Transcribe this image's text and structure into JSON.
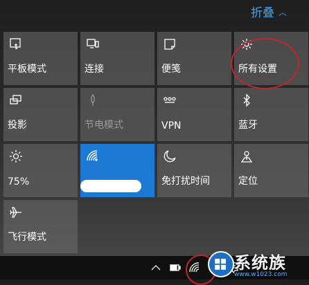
{
  "header": {
    "collapse_label": "折叠"
  },
  "tiles": [
    {
      "label": "平板模式",
      "icon": "tablet-mode-icon",
      "state": "off"
    },
    {
      "label": "连接",
      "icon": "connect-icon",
      "state": "off"
    },
    {
      "label": "便笺",
      "icon": "note-icon",
      "state": "off"
    },
    {
      "label": "所有设置",
      "icon": "gear-icon",
      "state": "off"
    },
    {
      "label": "投影",
      "icon": "project-icon",
      "state": "off"
    },
    {
      "label": "节电模式",
      "icon": "battery-saver-icon",
      "state": "disabled"
    },
    {
      "label": "VPN",
      "icon": "vpn-icon",
      "state": "off"
    },
    {
      "label": "蓝牙",
      "icon": "bluetooth-icon",
      "state": "off"
    },
    {
      "label": "75%",
      "icon": "brightness-icon",
      "state": "off"
    },
    {
      "label": "",
      "icon": "wifi-icon",
      "state": "on"
    },
    {
      "label": "免打扰时间",
      "icon": "moon-icon",
      "state": "off"
    },
    {
      "label": "定位",
      "icon": "location-icon",
      "state": "off"
    },
    {
      "label": "飞行模式",
      "icon": "airplane-icon",
      "state": "off"
    }
  ],
  "taskbar": {
    "icons": [
      "chevron-up-icon",
      "battery-icon",
      "wifi-icon",
      "volume-icon",
      "action-center-icon"
    ]
  },
  "watermark": {
    "text": "系统族",
    "url": "www.w1023.com"
  },
  "colors": {
    "accent": "#1d7ad4",
    "link": "#4aa3e8",
    "annotation": "#c0262b"
  }
}
